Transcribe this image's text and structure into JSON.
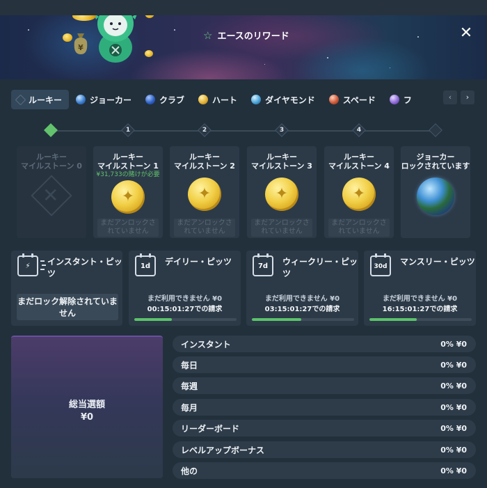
{
  "header": {
    "title": "エースのリワード",
    "title_icon": "star-icon",
    "close_icon": "close-icon"
  },
  "tabs": [
    {
      "label": "ルーキー",
      "gem": "#5a6c82",
      "active": true
    },
    {
      "label": "ジョーカー",
      "gem": "#3c7fd0"
    },
    {
      "label": "クラブ",
      "gem": "#2f63c7"
    },
    {
      "label": "ハート",
      "gem": "#e3b337"
    },
    {
      "label": "ダイヤモンド",
      "gem": "#4aa3d8"
    },
    {
      "label": "スペード",
      "gem": "#d05a3a"
    },
    {
      "label": "フ",
      "gem": "#8f6ad8"
    }
  ],
  "tab_nav": {
    "prev": "‹",
    "next": "›"
  },
  "track_nodes": [
    "",
    "1",
    "2",
    "3",
    "4",
    ""
  ],
  "milestones": [
    {
      "title1": "ルーキー",
      "title2": "マイルストーン 0",
      "req": "",
      "status": ""
    },
    {
      "title1": "ルーキー",
      "title2": "マイルストーン 1",
      "req": "¥31,733の賭けが必要",
      "status": "まだアンロックされていません"
    },
    {
      "title1": "ルーキー",
      "title2": "マイルストーン 2",
      "req": "",
      "status": "まだアンロックされていません"
    },
    {
      "title1": "ルーキー",
      "title2": "マイルストーン 3",
      "req": "",
      "status": "まだアンロックされていません"
    },
    {
      "title1": "ルーキー",
      "title2": "マイルストーン 4",
      "req": "",
      "status": "まだアンロックされていません"
    },
    {
      "title1": "ジョーカー",
      "title2": "ロックされています",
      "req": "",
      "status": ""
    }
  ],
  "pits": [
    {
      "name": "インスタント・ピッツ",
      "cal": "",
      "unlock": "まだロック解除されていません"
    },
    {
      "name": "デイリー・ピッツ",
      "cal": "1d",
      "line1": "まだ利用できません ¥0",
      "line2": "00:15:01:27での請求",
      "progress": 0.37
    },
    {
      "name": "ウィークリー・ピッツ",
      "cal": "7d",
      "line1": "まだ利用できません ¥0",
      "line2": "03:15:01:27での請求",
      "progress": 0.48
    },
    {
      "name": "マンスリー・ピッツ",
      "cal": "30d",
      "line1": "まだ利用できません ¥0",
      "line2": "16:15:01:27での請求",
      "progress": 0.46
    }
  ],
  "total": {
    "label": "総当選額",
    "value": "¥0"
  },
  "breakdown": [
    {
      "label": "インスタント",
      "value": "0% ¥0"
    },
    {
      "label": "毎日",
      "value": "0% ¥0"
    },
    {
      "label": "毎週",
      "value": "0% ¥0"
    },
    {
      "label": "毎月",
      "value": "0% ¥0"
    },
    {
      "label": "リーダーボード",
      "value": "0% ¥0"
    },
    {
      "label": "レベルアップボーナス",
      "value": "0% ¥0"
    },
    {
      "label": "他の",
      "value": "0% ¥0"
    }
  ]
}
